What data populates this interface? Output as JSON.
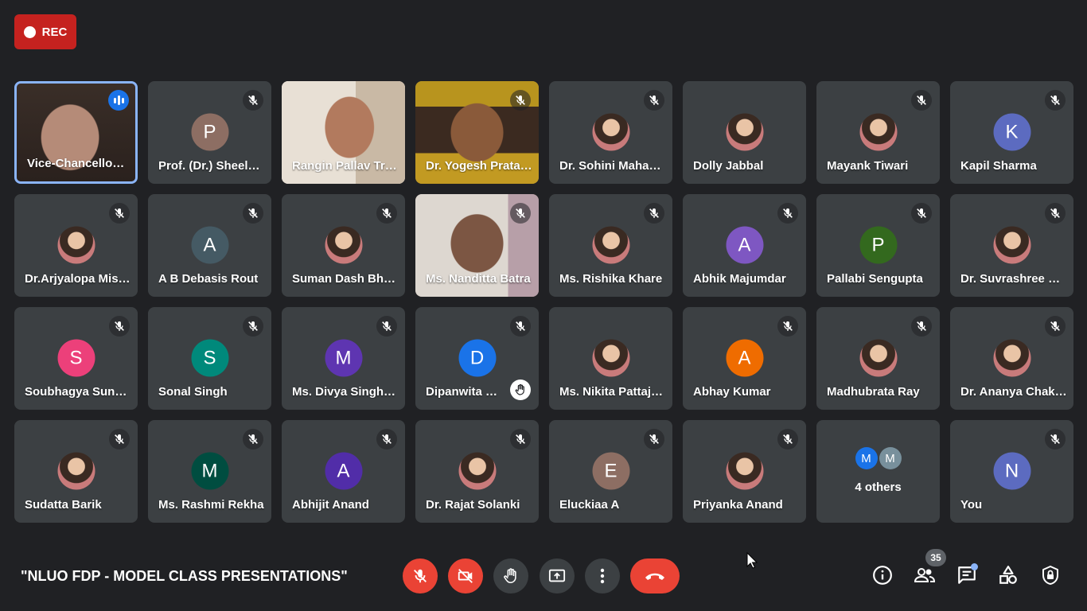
{
  "recording": {
    "label": "REC"
  },
  "participants": [
    {
      "name": "Vice-Chancellor (NLU Odisha)",
      "type": "video",
      "speaking": true,
      "muted": false
    },
    {
      "name": "Prof. (Dr.) Sheela Rai",
      "type": "initial",
      "initial": "P",
      "color": "#8d6e63",
      "muted": true
    },
    {
      "name": "Rangin Pallav Tripathy",
      "type": "video",
      "muted": false
    },
    {
      "name": "Dr. Yogesh Pratap Singh",
      "type": "video",
      "muted": true
    },
    {
      "name": "Dr. Sohini Mahapatra",
      "type": "photo",
      "muted": true
    },
    {
      "name": "Dolly Jabbal",
      "type": "photo",
      "muted": false
    },
    {
      "name": "Mayank Tiwari",
      "type": "photo",
      "muted": true
    },
    {
      "name": "Kapil Sharma",
      "type": "initial",
      "initial": "K",
      "color": "#5c6bc0",
      "muted": true
    },
    {
      "name": "Dr.Arjyalopa Mishra",
      "type": "photo",
      "muted": true
    },
    {
      "name": "A B Debasis Rout",
      "type": "initial",
      "initial": "A",
      "color": "#455a64",
      "muted": true
    },
    {
      "name": "Suman Dash Bhattamishra",
      "type": "photo",
      "muted": true
    },
    {
      "name": "Ms. Nanditta Batra",
      "type": "video",
      "muted": true
    },
    {
      "name": "Ms. Rishika Khare",
      "type": "photo",
      "muted": true
    },
    {
      "name": "Abhik Majumdar",
      "type": "initial",
      "initial": "A",
      "color": "#7e57c2",
      "muted": true
    },
    {
      "name": "Pallabi Sengupta",
      "type": "initial",
      "initial": "P",
      "color": "#33691e",
      "muted": true
    },
    {
      "name": "Dr. Suvrashree Panda",
      "type": "photo",
      "muted": true
    },
    {
      "name": "Soubhagya Sundar",
      "type": "initial",
      "initial": "S",
      "color": "#ec407a",
      "muted": true
    },
    {
      "name": "Sonal Singh",
      "type": "initial",
      "initial": "S",
      "color": "#00897b",
      "muted": true
    },
    {
      "name": "Ms. Divya Singh Rathore",
      "type": "initial",
      "initial": "M",
      "color": "#5e35b1",
      "muted": true
    },
    {
      "name": "Dipanwita Chakravortty",
      "type": "initial",
      "initial": "D",
      "color": "#1a73e8",
      "muted": true,
      "hand_raised": true
    },
    {
      "name": "Ms. Nikita Pattajoshi",
      "type": "photo",
      "muted": false
    },
    {
      "name": "Abhay Kumar",
      "type": "initial",
      "initial": "A",
      "color": "#ef6c00",
      "muted": true
    },
    {
      "name": "Madhubrata Ray",
      "type": "photo",
      "muted": true
    },
    {
      "name": "Dr. Ananya Chakraborty",
      "type": "photo",
      "muted": true
    },
    {
      "name": "Sudatta Barik",
      "type": "photo",
      "muted": true
    },
    {
      "name": "Ms. Rashmi Rekha",
      "type": "initial",
      "initial": "M",
      "color": "#004d40",
      "muted": true
    },
    {
      "name": "Abhijit Anand",
      "type": "initial",
      "initial": "A",
      "color": "#512da8",
      "muted": true
    },
    {
      "name": "Dr. Rajat Solanki",
      "type": "photo",
      "muted": true
    },
    {
      "name": "Eluckiaa A",
      "type": "initial",
      "initial": "E",
      "color": "#8d6e63",
      "muted": true
    },
    {
      "name": "Priyanka Anand",
      "type": "photo",
      "muted": true
    },
    {
      "name": "4 others",
      "type": "others",
      "initials": [
        "M",
        "M"
      ],
      "colors": [
        "#1a73e8",
        "#78909c"
      ]
    },
    {
      "name": "You",
      "type": "initial",
      "initial": "N",
      "color": "#5c6bc0",
      "muted": true
    }
  ],
  "bottom_bar": {
    "meeting_title": "\"NLUO FDP - MODEL CLASS PRESENTATIONS\"",
    "participant_count": "35",
    "icons": [
      "mic-off-icon",
      "camera-off-icon",
      "raise-hand-icon",
      "present-icon",
      "more-icon",
      "end-call-icon",
      "info-icon",
      "people-icon",
      "chat-icon",
      "activities-icon",
      "host-controls-icon"
    ]
  }
}
